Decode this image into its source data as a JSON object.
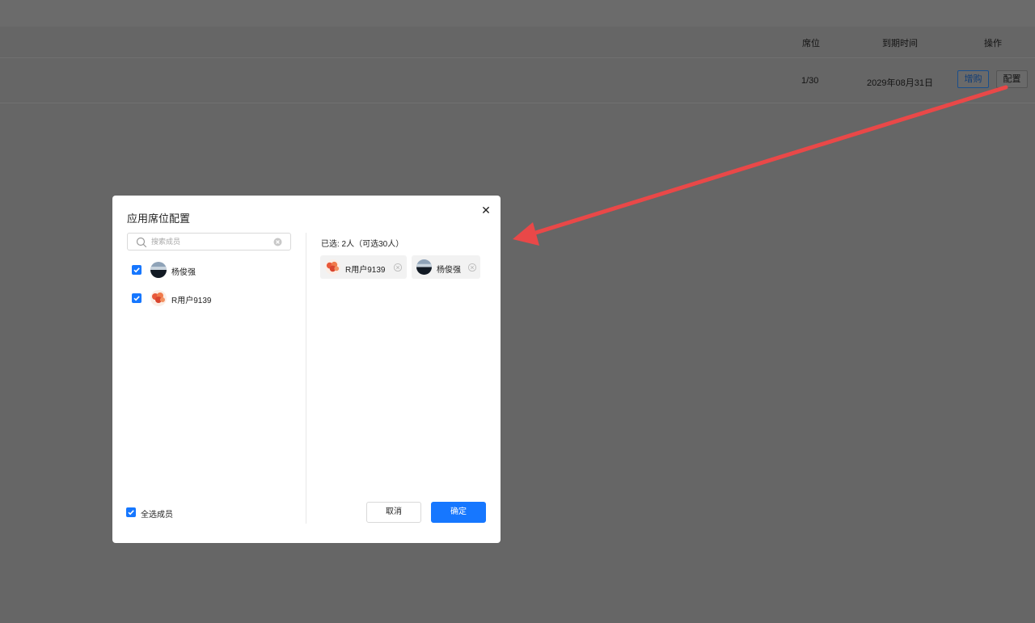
{
  "table": {
    "headers": {
      "seats": "席位",
      "expiry": "到期时间",
      "actions": "操作"
    },
    "row": {
      "seats": "1/30",
      "expiry": "2029年08月31日",
      "buy_label": "增购",
      "config_label": "配置"
    }
  },
  "modal": {
    "title": "应用席位配置",
    "search": {
      "placeholder": "搜索成员",
      "value": ""
    },
    "members": [
      {
        "name": "杨俊强",
        "checked": true,
        "avatar": "landscape"
      },
      {
        "name": "R用户9139",
        "checked": true,
        "avatar": "flowers"
      }
    ],
    "select_all_label": "全选成员",
    "selected_summary": "已选: 2人（可选30人）",
    "selected": [
      {
        "name": "R用户9139",
        "avatar": "flowers"
      },
      {
        "name": "杨俊强",
        "avatar": "landscape"
      }
    ],
    "cancel_label": "取消",
    "ok_label": "确定"
  },
  "colors": {
    "primary": "#1677ff",
    "annotation_arrow": "#e94848",
    "overlay": "#666666"
  },
  "icons": [
    "search-icon",
    "clear-icon",
    "close-icon",
    "checkbox-checked-icon",
    "remove-tag-icon",
    "annotation-arrow"
  ]
}
